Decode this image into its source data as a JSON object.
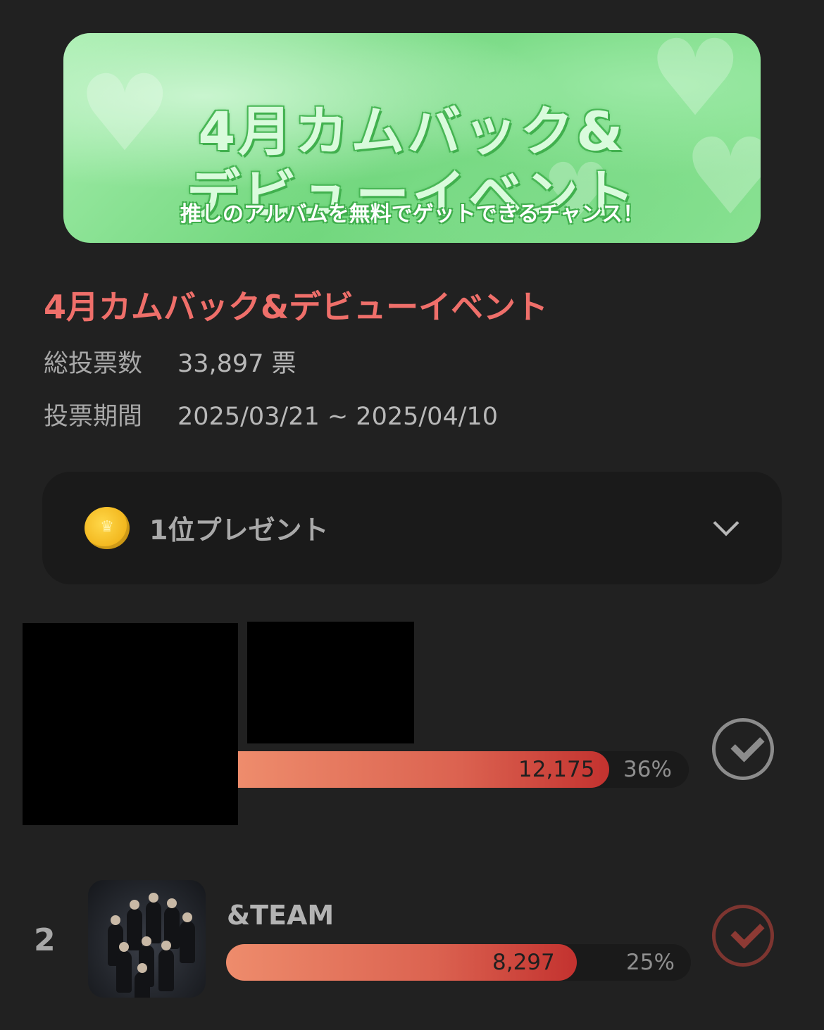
{
  "banner": {
    "title_line1": "4月カムバック&",
    "title_line2": "デビューイベント",
    "subtitle": "推しのアルバムを無料でゲットできるチャンス！"
  },
  "event": {
    "title": "4月カムバック&デビューイベント",
    "total_votes_label": "総投票数",
    "total_votes_value": "33,897 票",
    "period_label": "投票期間",
    "period_value": "2025/03/21 ~ 2025/04/10"
  },
  "prize": {
    "label": "1位プレゼント",
    "icon": "coin-crown-icon",
    "expand_icon": "chevron-down-icon"
  },
  "candidates": [
    {
      "rank": "",
      "name": "",
      "votes": "12,175",
      "percent": "36%",
      "share": 0.36,
      "check_state": "gray"
    },
    {
      "rank": "2",
      "name": "&TEAM",
      "votes": "8,297",
      "percent": "25%",
      "share": 0.25,
      "check_state": "red"
    }
  ],
  "colors": {
    "accent_title": "#ef6f6a",
    "bar_start": "#ee8c6c",
    "bar_end": "#c3322f",
    "background": "#212121"
  }
}
